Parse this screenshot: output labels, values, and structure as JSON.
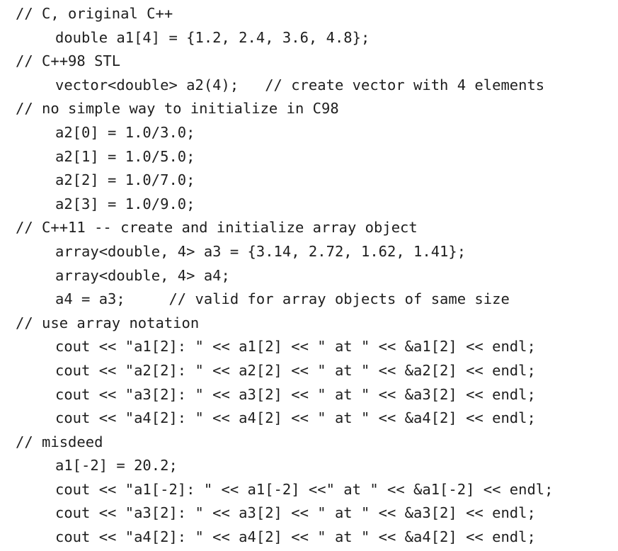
{
  "lines": [
    {
      "kind": "comment",
      "text": "// C, original C++"
    },
    {
      "kind": "code",
      "text": "double a1[4] = {1.2, 2.4, 3.6, 4.8};"
    },
    {
      "kind": "comment",
      "text": "// C++98 STL"
    },
    {
      "kind": "code",
      "text": "vector<double> a2(4);   // create vector with 4 elements"
    },
    {
      "kind": "comment",
      "text": "// no simple way to initialize in C98"
    },
    {
      "kind": "code",
      "text": "a2[0] = 1.0/3.0;"
    },
    {
      "kind": "code",
      "text": "a2[1] = 1.0/5.0;"
    },
    {
      "kind": "code",
      "text": "a2[2] = 1.0/7.0;"
    },
    {
      "kind": "code",
      "text": "a2[3] = 1.0/9.0;"
    },
    {
      "kind": "comment",
      "text": "// C++11 -- create and initialize array object"
    },
    {
      "kind": "code",
      "text": "array<double, 4> a3 = {3.14, 2.72, 1.62, 1.41};"
    },
    {
      "kind": "code",
      "text": "array<double, 4> a4;"
    },
    {
      "kind": "code",
      "text": "a4 = a3;     // valid for array objects of same size"
    },
    {
      "kind": "comment",
      "text": "// use array notation"
    },
    {
      "kind": "code",
      "text": "cout << \"a1[2]: \" << a1[2] << \" at \" << &a1[2] << endl;"
    },
    {
      "kind": "code",
      "text": "cout << \"a2[2]: \" << a2[2] << \" at \" << &a2[2] << endl;"
    },
    {
      "kind": "code",
      "text": "cout << \"a3[2]: \" << a3[2] << \" at \" << &a3[2] << endl;"
    },
    {
      "kind": "code",
      "text": "cout << \"a4[2]: \" << a4[2] << \" at \" << &a4[2] << endl;"
    },
    {
      "kind": "comment",
      "text": "// misdeed"
    },
    {
      "kind": "code",
      "text": "a1[-2] = 20.2;"
    },
    {
      "kind": "code",
      "text": "cout << \"a1[-2]: \" << a1[-2] <<\" at \" << &a1[-2] << endl;"
    },
    {
      "kind": "code",
      "text": "cout << \"a3[2]: \" << a3[2] << \" at \" << &a3[2] << endl;"
    },
    {
      "kind": "code",
      "text": "cout << \"a4[2]: \" << a4[2] << \" at \" << &a4[2] << endl;"
    }
  ]
}
